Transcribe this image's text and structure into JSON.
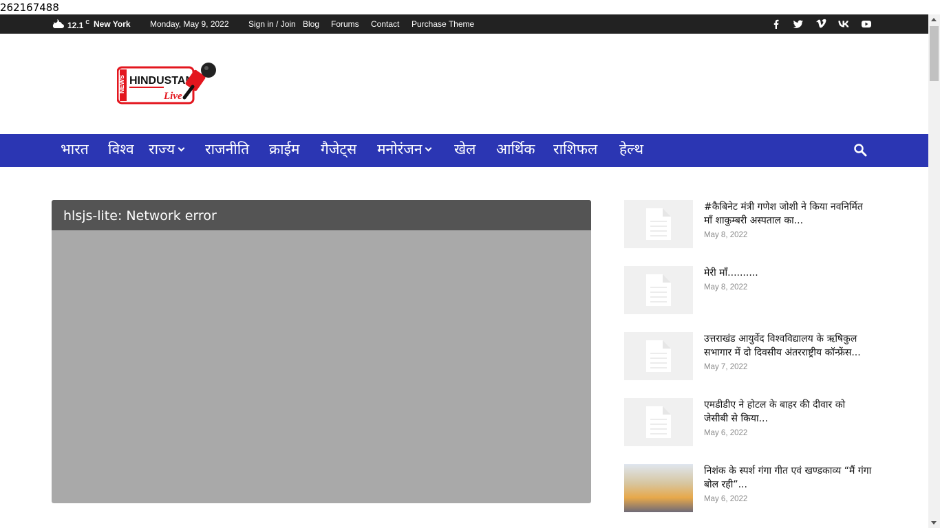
{
  "debug_id": "262167488",
  "topbar": {
    "temperature": "12.1",
    "temp_unit": "C",
    "city": "New York",
    "date": "Monday, May 9, 2022",
    "links": [
      "Sign in / Join",
      "Blog",
      "Forums",
      "Contact",
      "Purchase Theme"
    ],
    "social_icons": [
      "facebook-icon",
      "twitter-icon",
      "vimeo-icon",
      "vk-icon",
      "youtube-icon"
    ]
  },
  "logo": {
    "text_news": "NEWS",
    "text_main": "HINDUSTAN",
    "text_live": "Live"
  },
  "nav": {
    "items": [
      "भारत",
      "विश्व",
      "राज्य",
      "राजनीति",
      "क्राईम",
      "गैजेट्स",
      "मनोरंजन",
      "खेल",
      "आर्थिक",
      "राशिफल",
      "हेल्थ"
    ]
  },
  "player": {
    "error_message": "hlsjs-lite: Network error"
  },
  "sidebar": {
    "posts": [
      {
        "title": "#कैबिनेट मंत्री गणेश जोशी ने किया नवनिर्मित माँ शाकुम्बरी अस्पताल का...",
        "date": "May 8, 2022"
      },
      {
        "title": "मेरी माँ..........",
        "date": "May 8, 2022"
      },
      {
        "title": "उत्तराखंड आयुर्वेद विश्वविद्यालय के ऋषिकुल सभागार में दो दिवसीय अंतरराष्ट्रीय कॉन्फ्रेंस...",
        "date": "May 7, 2022"
      },
      {
        "title": "एमडीडीए ने होटल के बाहर की दीवार को जेसीबी से किया...",
        "date": "May 6, 2022"
      },
      {
        "title": "निशंक के स्पर्श गंगा गीत एवं खण्डकाव्य “मैं गंगा बोल रही”...",
        "date": "May 6, 2022"
      }
    ]
  },
  "colors": {
    "topbar_bg": "#222222",
    "nav_bg": "#2b36b3",
    "player_bg": "#a9a9a9",
    "player_bar": "#545454",
    "logo_red": "#e3161e"
  }
}
